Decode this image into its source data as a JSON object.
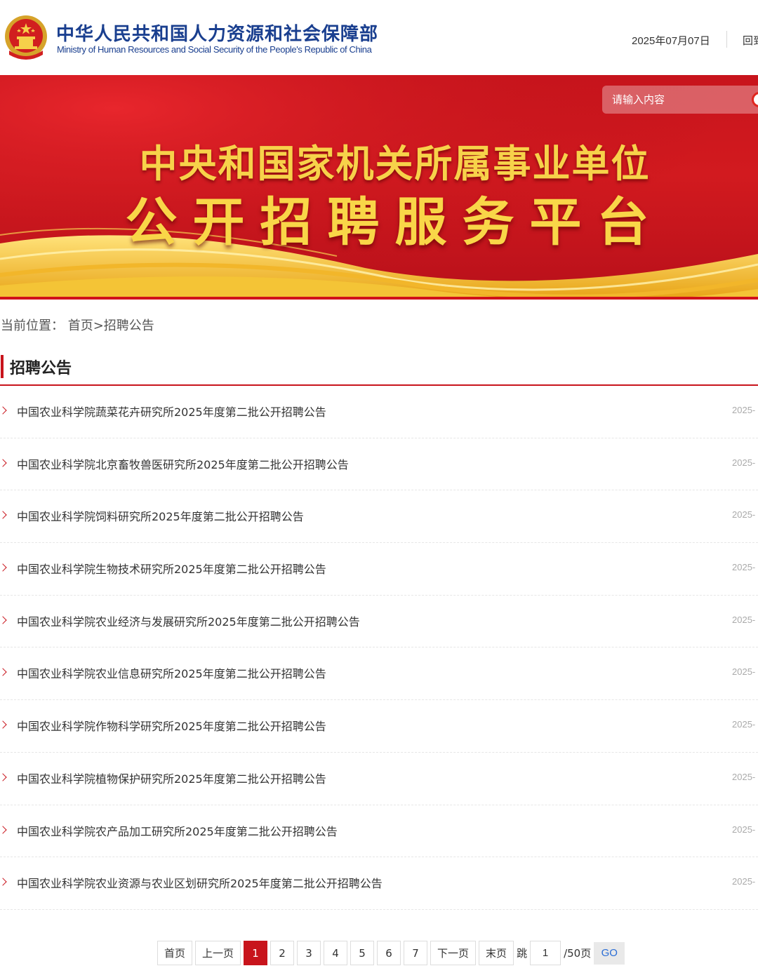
{
  "header": {
    "org_name_cn": "中华人民共和国人力资源和社会保障部",
    "org_name_en": "Ministry of Human Resources and Social Security of the People's Republic of China",
    "date": "2025年07月07日",
    "home_link": "回到首页"
  },
  "banner": {
    "title_line1": "中央和国家机关所属事业单位",
    "title_line2": "公开招聘服务平台",
    "search_placeholder": "请输入内容"
  },
  "breadcrumb": "当前位置：  首页>招聘公告",
  "section_title": "招聘公告",
  "items": [
    {
      "title": "中国农业科学院蔬菜花卉研究所2025年度第二批公开招聘公告",
      "date": "2025-"
    },
    {
      "title": "中国农业科学院北京畜牧兽医研究所2025年度第二批公开招聘公告",
      "date": "2025-"
    },
    {
      "title": "中国农业科学院饲料研究所2025年度第二批公开招聘公告",
      "date": "2025-"
    },
    {
      "title": "中国农业科学院生物技术研究所2025年度第二批公开招聘公告",
      "date": "2025-"
    },
    {
      "title": "中国农业科学院农业经济与发展研究所2025年度第二批公开招聘公告",
      "date": "2025-"
    },
    {
      "title": "中国农业科学院农业信息研究所2025年度第二批公开招聘公告",
      "date": "2025-"
    },
    {
      "title": "中国农业科学院作物科学研究所2025年度第二批公开招聘公告",
      "date": "2025-"
    },
    {
      "title": "中国农业科学院植物保护研究所2025年度第二批公开招聘公告",
      "date": "2025-"
    },
    {
      "title": "中国农业科学院农产品加工研究所2025年度第二批公开招聘公告",
      "date": "2025-"
    },
    {
      "title": "中国农业科学院农业资源与农业区划研究所2025年度第二批公开招聘公告",
      "date": "2025-"
    }
  ],
  "pagination": {
    "first": "首页",
    "prev": "上一页",
    "pages": [
      "1",
      "2",
      "3",
      "4",
      "5",
      "6",
      "7"
    ],
    "current": "1",
    "next": "下一页",
    "last": "末页",
    "jump_label": "跳",
    "jump_value": "1",
    "total": "/50页",
    "go": "GO"
  },
  "colors": {
    "brand_red": "#c8141c",
    "brand_blue": "#1a3f8f",
    "banner_gold": "#f7d24a"
  }
}
